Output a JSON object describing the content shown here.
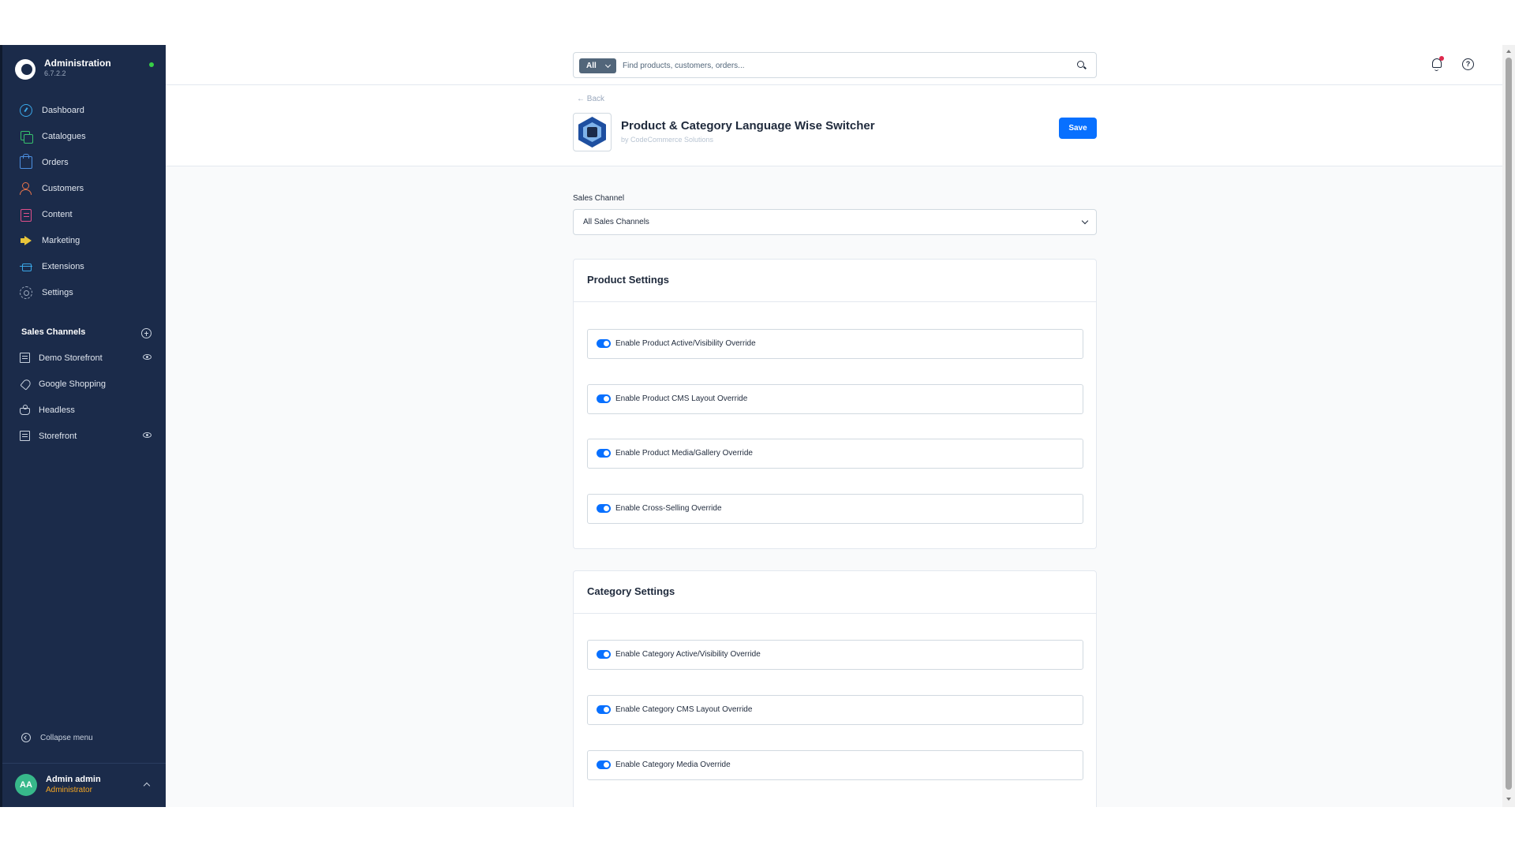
{
  "brand": {
    "title": "Administration",
    "version": "6.7.2.2"
  },
  "nav": {
    "items": [
      {
        "label": "Dashboard",
        "icon": "dashboard-icon"
      },
      {
        "label": "Catalogues",
        "icon": "catalogues-icon"
      },
      {
        "label": "Orders",
        "icon": "orders-icon"
      },
      {
        "label": "Customers",
        "icon": "customers-icon"
      },
      {
        "label": "Content",
        "icon": "content-icon"
      },
      {
        "label": "Marketing",
        "icon": "marketing-icon"
      },
      {
        "label": "Extensions",
        "icon": "extensions-icon"
      },
      {
        "label": "Settings",
        "icon": "settings-icon"
      }
    ]
  },
  "sales_channels": {
    "header": "Sales Channels",
    "items": [
      {
        "label": "Demo Storefront",
        "icon": "storefront-icon",
        "visible_toggle": true
      },
      {
        "label": "Google Shopping",
        "icon": "rocket-icon",
        "visible_toggle": false
      },
      {
        "label": "Headless",
        "icon": "headless-icon",
        "visible_toggle": false
      },
      {
        "label": "Storefront",
        "icon": "storefront-icon",
        "visible_toggle": true
      }
    ]
  },
  "sidebar_footer": {
    "collapse_label": "Collapse menu",
    "user": {
      "initials": "AA",
      "name": "Admin admin",
      "role": "Administrator"
    }
  },
  "search": {
    "type_label": "All",
    "placeholder": "Find products, customers, orders..."
  },
  "header": {
    "back_label": "← Back",
    "plugin_title": "Product & Category Language Wise Switcher",
    "plugin_author": "by CodeCommerce Solutions",
    "save_label": "Save"
  },
  "content": {
    "sales_channel_label": "Sales Channel",
    "sales_channel_value": "All Sales Channels",
    "product_settings": {
      "title": "Product Settings",
      "options": [
        {
          "label": "Enable Product Active/Visibility Override",
          "enabled": true
        },
        {
          "label": "Enable Product CMS Layout Override",
          "enabled": true
        },
        {
          "label": "Enable Product Media/Gallery Override",
          "enabled": true
        },
        {
          "label": "Enable Cross-Selling Override",
          "enabled": true
        }
      ]
    },
    "category_settings": {
      "title": "Category Settings",
      "options": [
        {
          "label": "Enable Category Active/Visibility Override",
          "enabled": true
        },
        {
          "label": "Enable Category CMS Layout Override",
          "enabled": true
        },
        {
          "label": "Enable Category Media Override",
          "enabled": true
        }
      ]
    }
  },
  "colors": {
    "sidebar_bg": "#1b2b4a",
    "primary": "#0870ff",
    "status_online": "#37d046",
    "role_text": "#f5a623",
    "notification_dot": "#de294c"
  }
}
